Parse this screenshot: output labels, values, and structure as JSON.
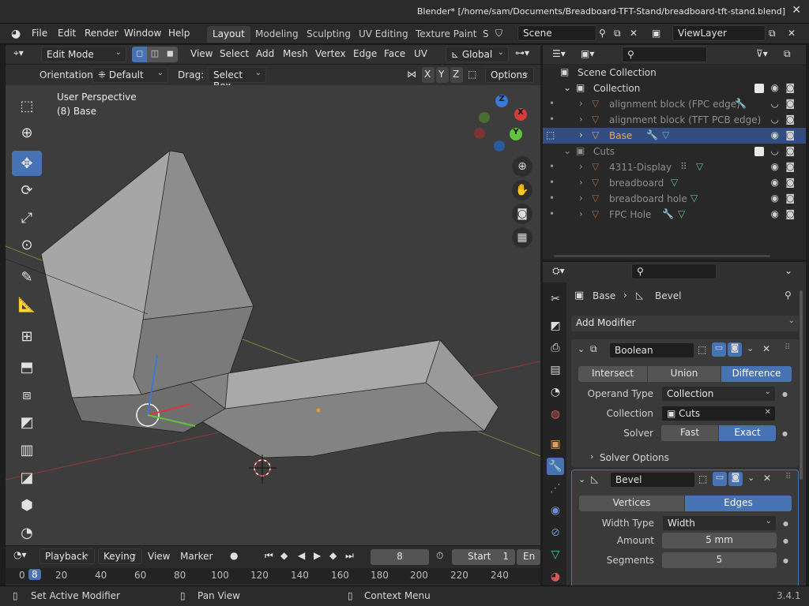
{
  "window": {
    "title": "Blender* [/home/sam/Documents/Breadboard-TFT-Stand/breadboard-tft-stand.blend]",
    "close": "✕"
  },
  "menu": [
    "File",
    "Edit",
    "Render",
    "Window",
    "Help"
  ],
  "workspaces": [
    "Layout",
    "Modeling",
    "Sculpting",
    "UV Editing",
    "Texture Paint",
    "S"
  ],
  "scene": {
    "value": "Scene"
  },
  "viewlayer": {
    "value": "ViewLayer"
  },
  "viewport_header": {
    "mode": "Edit Mode",
    "menus": [
      "View",
      "Select",
      "Add",
      "Mesh",
      "Vertex",
      "Edge",
      "Face",
      "UV"
    ],
    "transform_orientation": "Global"
  },
  "tool_settings": {
    "orientation_label": "Orientation:",
    "orientation_value": "Default",
    "drag_label": "Drag:",
    "drag_value": "Select Box",
    "axes": [
      "X",
      "Y",
      "Z"
    ],
    "options": "Options"
  },
  "viewport": {
    "perspective": "User Perspective",
    "object_info": "(8) Base",
    "gizmo_axes": [
      "Z",
      "X",
      "Y"
    ]
  },
  "outliner": {
    "scene_collection": "Scene Collection",
    "rows": [
      {
        "label": "Collection",
        "indent": 1
      },
      {
        "label": "alignment block (FPC edge)",
        "indent": 2
      },
      {
        "label": "alignment block (TFT PCB edge)",
        "indent": 2
      },
      {
        "label": "Base",
        "indent": 2
      },
      {
        "label": "Cuts",
        "indent": 1
      },
      {
        "label": "4311-Display",
        "indent": 2
      },
      {
        "label": "breadboard",
        "indent": 2
      },
      {
        "label": "breadboard hole",
        "indent": 2
      },
      {
        "label": "FPC Hole",
        "indent": 2
      }
    ]
  },
  "properties": {
    "breadcrumb": [
      "Base",
      "Bevel"
    ],
    "add_modifier": "Add Modifier",
    "boolean": {
      "name": "Boolean",
      "ops": [
        "Intersect",
        "Union",
        "Difference"
      ],
      "active_op": "Difference",
      "operand_type_label": "Operand Type",
      "operand_type": "Collection",
      "collection_label": "Collection",
      "collection": "Cuts",
      "solver_label": "Solver",
      "solvers": [
        "Fast",
        "Exact"
      ],
      "active_solver": "Exact",
      "solver_options": "Solver Options"
    },
    "bevel": {
      "name": "Bevel",
      "affect": [
        "Vertices",
        "Edges"
      ],
      "active_affect": "Edges",
      "width_type_label": "Width Type",
      "width_type": "Width",
      "amount_label": "Amount",
      "amount": "5 mm",
      "segments_label": "Segments",
      "segments": "5"
    }
  },
  "timeline": {
    "menus": [
      "Playback",
      "Keying",
      "View",
      "Marker"
    ],
    "current_frame": "8",
    "start_label": "Start",
    "start": "1",
    "end_label": "En",
    "ruler": [
      "0",
      "8",
      "20",
      "40",
      "60",
      "80",
      "100",
      "120",
      "140",
      "160",
      "180",
      "200",
      "220",
      "240"
    ]
  },
  "status": {
    "left": "Set Active Modifier",
    "middle": "Pan View",
    "right": "Context Menu",
    "version": "3.4.1"
  },
  "colors": {
    "accent": "#4772b3",
    "selection_row": "#334d80",
    "object_orange": "#e09e5c"
  }
}
